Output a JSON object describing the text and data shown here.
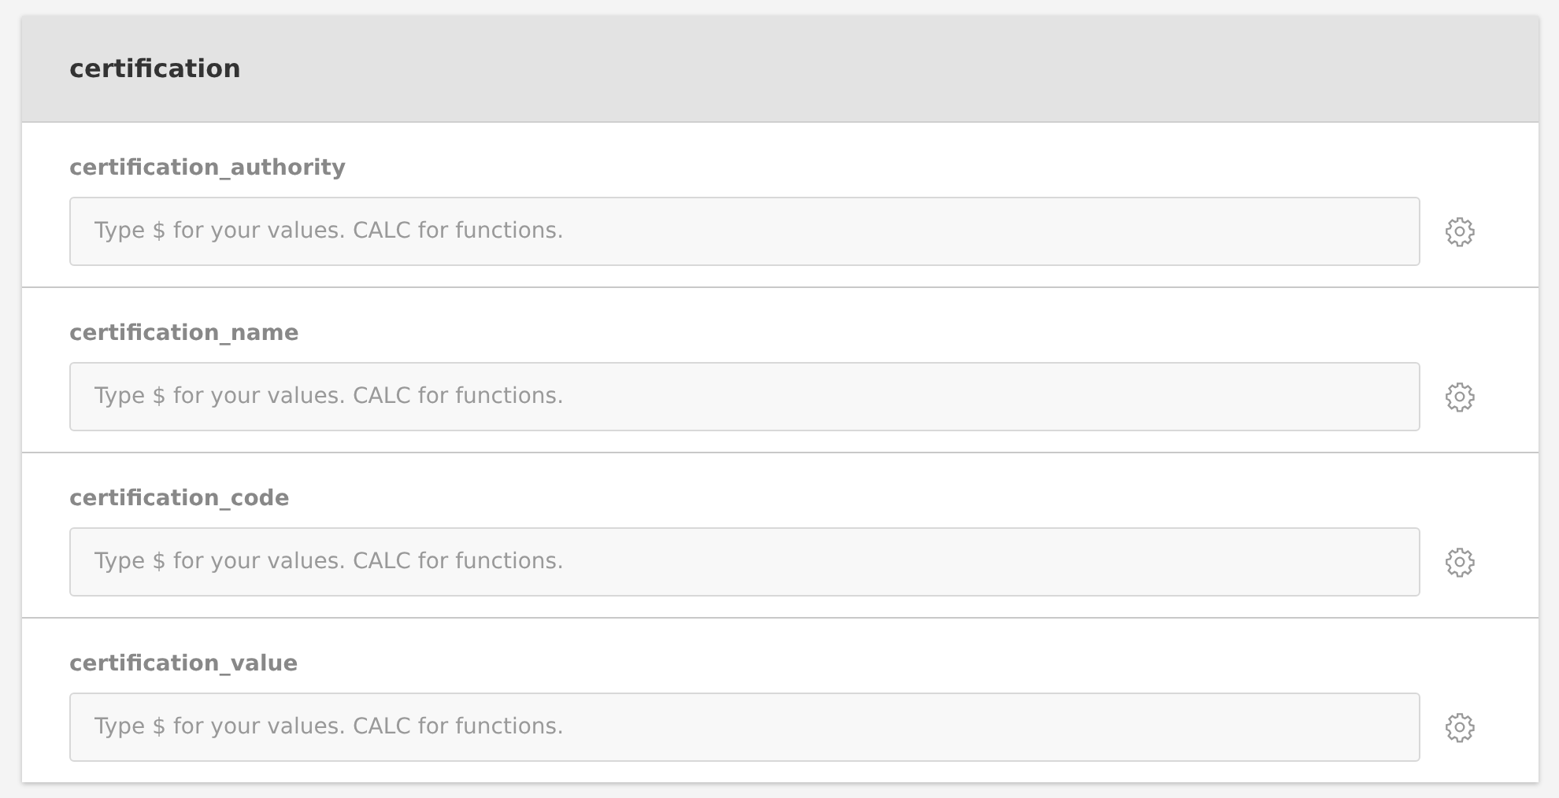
{
  "panel": {
    "title": "certification"
  },
  "fields": [
    {
      "label": "certification_authority",
      "placeholder": "Type $ for your values. CALC for functions."
    },
    {
      "label": "certification_name",
      "placeholder": "Type $ for your values. CALC for functions."
    },
    {
      "label": "certification_code",
      "placeholder": "Type $ for your values. CALC for functions."
    },
    {
      "label": "certification_value",
      "placeholder": "Type $ for your values. CALC for functions."
    }
  ]
}
